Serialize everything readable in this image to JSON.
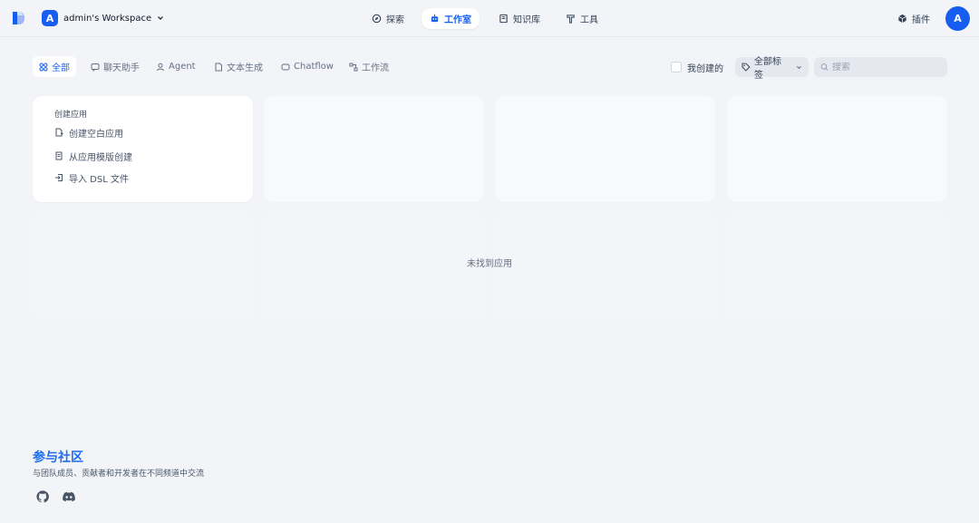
{
  "header": {
    "workspace_initial": "A",
    "workspace_name": "admin's Workspace",
    "nav": [
      {
        "label": "探索",
        "icon": "compass-icon"
      },
      {
        "label": "工作室",
        "icon": "robot-icon",
        "active": true
      },
      {
        "label": "知识库",
        "icon": "book-icon"
      },
      {
        "label": "工具",
        "icon": "hammer-icon"
      }
    ],
    "plugin_label": "插件",
    "user_initial": "A"
  },
  "filters": {
    "tabs": [
      {
        "label": "全部",
        "icon": "grid-icon",
        "active": true
      },
      {
        "label": "聊天助手",
        "icon": "chat-icon"
      },
      {
        "label": "Agent",
        "icon": "agent-icon"
      },
      {
        "label": "文本生成",
        "icon": "document-icon"
      },
      {
        "label": "Chatflow",
        "icon": "chatflow-icon"
      },
      {
        "label": "工作流",
        "icon": "workflow-icon"
      }
    ],
    "created_by_me": "我创建的",
    "all_tags": "全部标签",
    "search_placeholder": "搜索"
  },
  "create_card": {
    "title": "创建应用",
    "items": [
      {
        "label": "创建空白应用",
        "icon": "file-plus-icon"
      },
      {
        "label": "从应用模版创建",
        "icon": "template-icon"
      },
      {
        "label": "导入 DSL 文件",
        "icon": "import-icon"
      }
    ]
  },
  "empty_message": "未找到应用",
  "community": {
    "title": "参与社区",
    "subtitle": "与团队成员、贡献者和开发者在不同频道中交流",
    "links": [
      {
        "icon": "github-icon"
      },
      {
        "icon": "discord-icon"
      }
    ]
  },
  "colors": {
    "accent": "#155eef",
    "background": "#f2f4f7",
    "community_title": "#1d6cf0"
  }
}
